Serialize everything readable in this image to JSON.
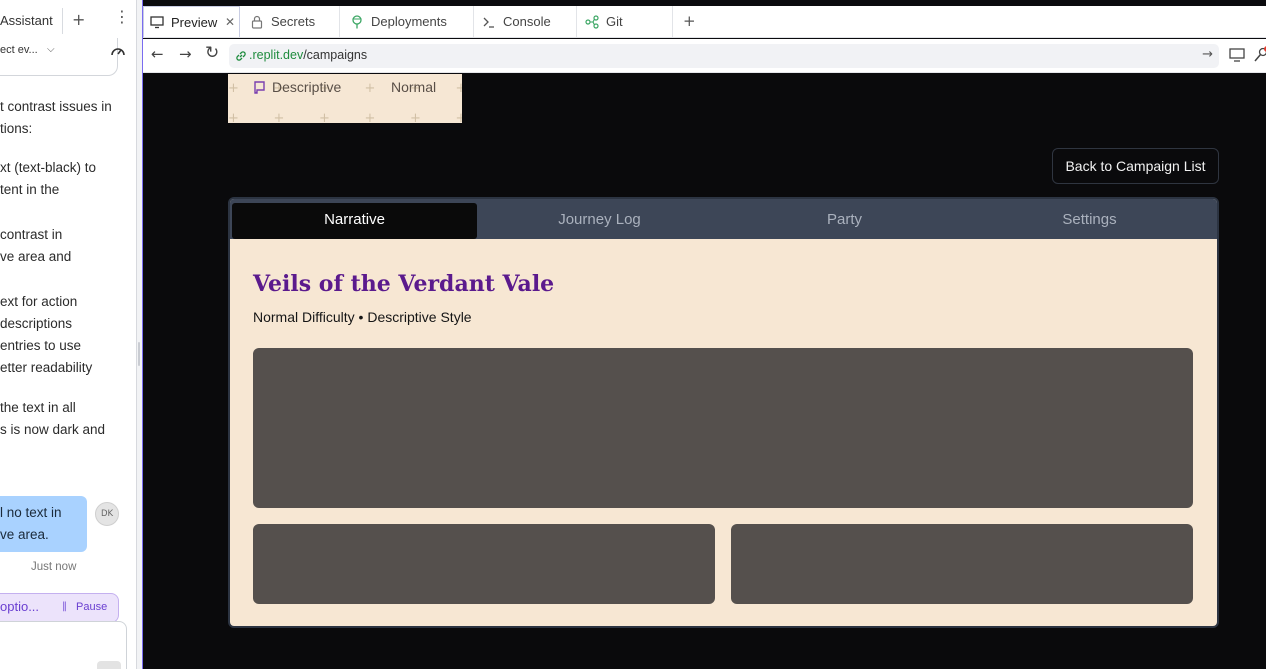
{
  "assistant": {
    "tab_title": "Assistant",
    "new_tab": "+",
    "menu": "⋮",
    "select_text": "ect ev...",
    "messages": [
      {
        "lines": [
          "t contrast issues in",
          "tions:"
        ]
      },
      {
        "lines": [
          "xt (text-black) to",
          "tent in the"
        ]
      },
      {
        "lines": [
          "contrast in",
          "ve area and"
        ]
      },
      {
        "lines": [
          "ext for action",
          "descriptions",
          "entries to use",
          "etter readability"
        ]
      },
      {
        "lines": [
          "the text in all",
          "s is now dark and"
        ]
      }
    ],
    "user_message": [
      "l no text in",
      "ve area."
    ],
    "avatar_initials": "DK",
    "timestamp": "Just now",
    "status_text": "optio...",
    "pause_label": "Pause"
  },
  "browser": {
    "tabs": [
      {
        "label": "Preview",
        "icon": "monitor-icon"
      },
      {
        "label": "Secrets",
        "icon": "lock-icon"
      },
      {
        "label": "Deployments",
        "icon": "deploy-icon"
      },
      {
        "label": "Console",
        "icon": "terminal-icon"
      },
      {
        "label": "Git",
        "icon": "git-icon"
      }
    ],
    "new_tab": "+",
    "url_host": ".replit.dev",
    "url_path": "/campaigns"
  },
  "app": {
    "chips": {
      "style": "Descriptive",
      "difficulty": "Normal"
    },
    "back_button": "Back to Campaign List",
    "tabs": [
      "Narrative",
      "Journey Log",
      "Party",
      "Settings"
    ],
    "active_tab": "Narrative",
    "campaign_title": "Veils of the Verdant Vale",
    "campaign_subtitle": "Normal Difficulty • Descriptive Style"
  },
  "colors": {
    "accent_purple": "#5b1a8d",
    "card_bg": "#f7e7d3",
    "tab_bar": "#3d4657",
    "panel": "#55504d",
    "url_host": "#1f8c3e"
  }
}
